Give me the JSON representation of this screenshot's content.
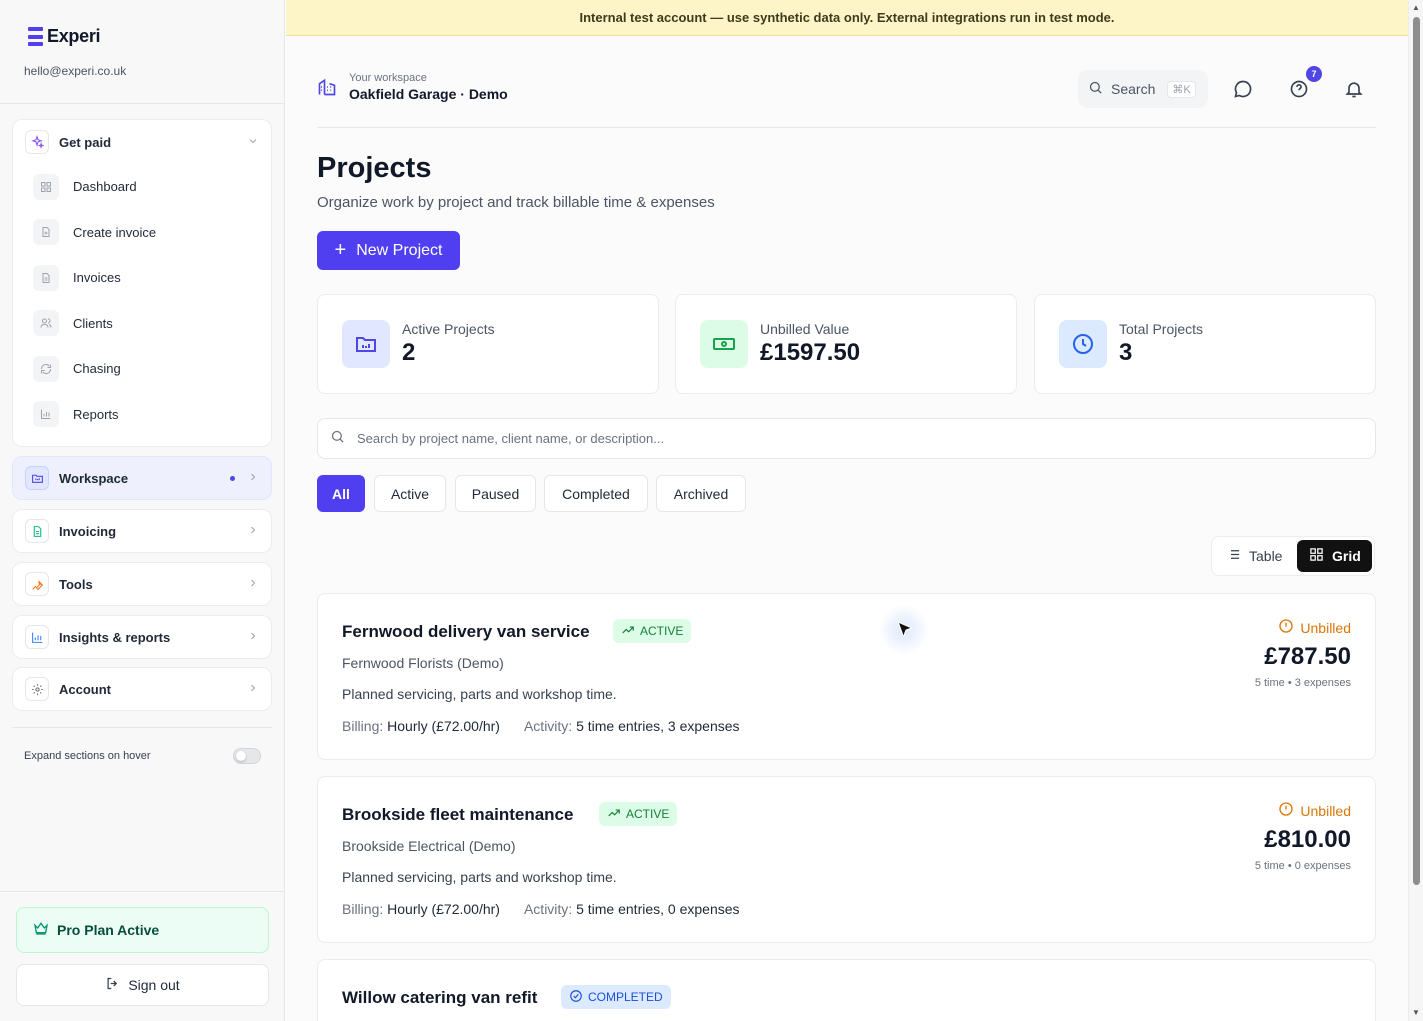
{
  "brand": {
    "name": "Experi",
    "email": "hello@experi.co.uk"
  },
  "sidebar": {
    "get_paid": {
      "label": "Get paid",
      "items": [
        {
          "label": "Dashboard",
          "icon": "grid-icon"
        },
        {
          "label": "Create invoice",
          "icon": "file-plus-icon"
        },
        {
          "label": "Invoices",
          "icon": "document-icon"
        },
        {
          "label": "Clients",
          "icon": "users-icon"
        },
        {
          "label": "Chasing",
          "icon": "refresh-icon"
        },
        {
          "label": "Reports",
          "icon": "bar-chart-icon"
        }
      ]
    },
    "sections": [
      {
        "label": "Workspace",
        "icon": "folder-icon",
        "active": true
      },
      {
        "label": "Invoicing",
        "icon": "receipt-icon"
      },
      {
        "label": "Tools",
        "icon": "wrench-icon"
      },
      {
        "label": "Insights & reports",
        "icon": "chart-icon"
      },
      {
        "label": "Account",
        "icon": "gear-icon"
      }
    ],
    "expand_label": "Expand sections on hover",
    "expand_enabled": false,
    "plan_label": "Pro Plan Active",
    "signout_label": "Sign out"
  },
  "banner": {
    "text": "Internal test account — use synthetic data only. External integrations run in test mode."
  },
  "header": {
    "workspace_caption": "Your workspace",
    "workspace_name": "Oakfield Garage · Demo",
    "search_label": "Search",
    "search_shortcut": "⌘K",
    "help_badge": "7"
  },
  "page": {
    "title": "Projects",
    "subtitle": "Organize work by project and track billable time & expenses",
    "new_button": "New Project"
  },
  "stats": [
    {
      "label": "Active Projects",
      "value": "2",
      "icon": "folder-chart-icon",
      "color": "#4f46e5",
      "bg": "#e0e7ff"
    },
    {
      "label": "Unbilled Value",
      "value": "£1597.50",
      "icon": "banknote-icon",
      "color": "#16a34a",
      "bg": "#dcfce7"
    },
    {
      "label": "Total Projects",
      "value": "3",
      "icon": "clock-icon",
      "color": "#2563eb",
      "bg": "#dbeafe"
    }
  ],
  "search": {
    "placeholder": "Search by project name, client name, or description...",
    "value": ""
  },
  "filters": [
    {
      "label": "All",
      "active": true
    },
    {
      "label": "Active"
    },
    {
      "label": "Paused"
    },
    {
      "label": "Completed"
    },
    {
      "label": "Archived"
    }
  ],
  "view": {
    "table_label": "Table",
    "grid_label": "Grid",
    "selected": "Grid"
  },
  "projects": [
    {
      "name": "Fernwood delivery van service",
      "status": "ACTIVE",
      "client": "Fernwood Florists (Demo)",
      "description": "Planned servicing, parts and workshop time.",
      "billing_label": "Billing:",
      "billing": "Hourly (£72.00/hr)",
      "activity_label": "Activity:",
      "activity": "5 time entries, 3 expenses",
      "unbilled_label": "Unbilled",
      "unbilled_amount": "£787.50",
      "unbilled_sub": "5 time • 3 expenses"
    },
    {
      "name": "Brookside fleet maintenance",
      "status": "ACTIVE",
      "client": "Brookside Electrical (Demo)",
      "description": "Planned servicing, parts and workshop time.",
      "billing_label": "Billing:",
      "billing": "Hourly (£72.00/hr)",
      "activity_label": "Activity:",
      "activity": "5 time entries, 0 expenses",
      "unbilled_label": "Unbilled",
      "unbilled_amount": "£810.00",
      "unbilled_sub": "5 time • 0 expenses"
    },
    {
      "name": "Willow catering van refit",
      "status": "COMPLETED"
    }
  ]
}
